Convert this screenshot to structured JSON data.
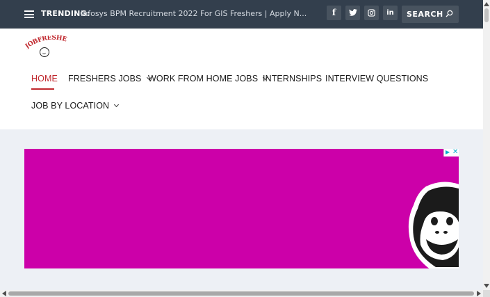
{
  "topbar": {
    "trending_label": "TRENDING:",
    "trending_text": "Infosys BPM Recruitment 2022 For GIS Freshers | Apply N...",
    "social": [
      {
        "name": "facebook-icon",
        "glyph": "f"
      },
      {
        "name": "twitter-icon",
        "glyph": "t"
      },
      {
        "name": "instagram-icon",
        "glyph": "ig"
      },
      {
        "name": "linkedin-icon",
        "glyph": "in"
      }
    ],
    "search_label": "SEARCH"
  },
  "logo": {
    "text": "JOBFRESHERS"
  },
  "nav": {
    "home": "HOME",
    "freshers_jobs": "FRESHERS JOBS",
    "work_from_home": "WORK FROM HOME JOBS",
    "internships": "INTERNSHIPS",
    "interview_questions": "INTERVIEW QUESTIONS",
    "job_by_location": "JOB BY LOCATION"
  },
  "colors": {
    "topbar": "#333f4d",
    "accent": "#c0272d",
    "ad_background": "#cc00a9"
  }
}
